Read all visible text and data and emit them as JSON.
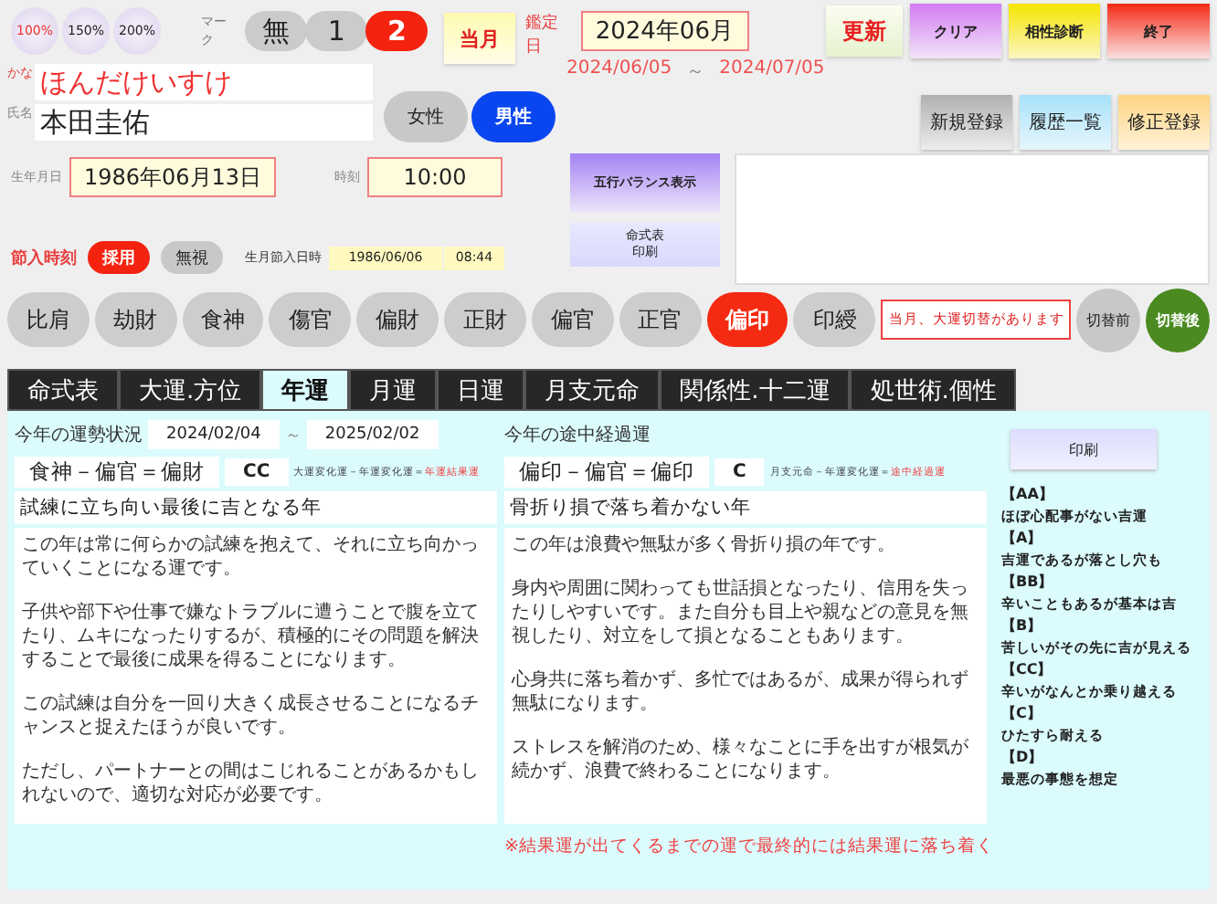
{
  "zoom_buttons": [
    {
      "label": "100%",
      "selected": true
    },
    {
      "label": "150%",
      "selected": false
    },
    {
      "label": "200%",
      "selected": false
    }
  ],
  "mark": {
    "label": "マーク",
    "options": [
      {
        "label": "無",
        "selected": false
      },
      {
        "label": "1",
        "selected": false
      },
      {
        "label": "2",
        "selected": true
      }
    ]
  },
  "month_button": "当月",
  "appraisal": {
    "label": "鑑定日",
    "value": "2024年06月",
    "range_start": "2024/06/05",
    "range_sep": "～",
    "range_end": "2024/07/05"
  },
  "update_button": "更新",
  "top_buttons": [
    {
      "label": "クリア",
      "kind": "clear"
    },
    {
      "label": "相性診断",
      "kind": "match"
    },
    {
      "label": "終了",
      "kind": "exit"
    }
  ],
  "record_buttons": [
    {
      "label": "新規登録",
      "kind": "new"
    },
    {
      "label": "履歴一覧",
      "kind": "history"
    },
    {
      "label": "修正登録",
      "kind": "edit"
    }
  ],
  "kana": {
    "label": "かな",
    "value": "ほんだけいすけ"
  },
  "name": {
    "label": "氏名",
    "value": "本田圭佑"
  },
  "gender": [
    {
      "label": "女性",
      "selected": false
    },
    {
      "label": "男性",
      "selected": true
    }
  ],
  "birth": {
    "label": "生年月日",
    "value": "1986年06月13日"
  },
  "time": {
    "label": "時刻",
    "value": "10:00"
  },
  "gogyo_button": "五行バランス表示",
  "print_chart_button": [
    "命式表",
    "印刷"
  ],
  "setsuiri": {
    "label": "節入時刻",
    "options": [
      {
        "label": "採用",
        "selected": true
      },
      {
        "label": "無視",
        "selected": false
      }
    ],
    "birth_month_label": "生月節入日時",
    "date": "1986/06/06",
    "time": "08:44"
  },
  "star_buttons": [
    {
      "label": "比肩",
      "selected": false
    },
    {
      "label": "劫財",
      "selected": false
    },
    {
      "label": "食神",
      "selected": false
    },
    {
      "label": "傷官",
      "selected": false
    },
    {
      "label": "偏財",
      "selected": false
    },
    {
      "label": "正財",
      "selected": false
    },
    {
      "label": "偏官",
      "selected": false
    },
    {
      "label": "正官",
      "selected": false
    },
    {
      "label": "偏印",
      "selected": true
    },
    {
      "label": "印綬",
      "selected": false
    }
  ],
  "notice": "当月、大運切替があります",
  "switch": [
    {
      "label": "切替前",
      "selected": false
    },
    {
      "label": "切替後",
      "selected": true
    }
  ],
  "tabs": [
    {
      "label": "命式表",
      "selected": false
    },
    {
      "label": "大運.方位",
      "selected": false
    },
    {
      "label": "年運",
      "selected": true
    },
    {
      "label": "月運",
      "selected": false
    },
    {
      "label": "日運",
      "selected": false
    },
    {
      "label": "月支元命",
      "selected": false
    },
    {
      "label": "関係性.十二運",
      "selected": false
    },
    {
      "label": "処世術.個性",
      "selected": false
    }
  ],
  "year": {
    "heading": "今年の運勢状況",
    "from": "2024/02/04",
    "sep": "～",
    "to": "2025/02/02",
    "formula": "食神－偏官＝偏財",
    "grade": "CC",
    "note": "大運変化運－年運変化運＝",
    "note_result": "年運結果運",
    "title": "試練に立ち向い最後に吉となる年",
    "paragraphs": [
      "この年は常に何らかの試練を抱えて、それに立ち向かっていくことになる運です。",
      "子供や部下や仕事で嫌なトラブルに遭うことで腹を立てたり、ムキになったりするが、積極的にその問題を解決することで最後に成果を得ることになります。",
      "この試練は自分を一回り大きく成長させることになるチャンスと捉えたほうが良いです。",
      "ただし、パートナーとの間はこじれることがあるかもしれないので、適切な対応が必要です。"
    ]
  },
  "interim": {
    "heading": "今年の途中経過運",
    "formula": "偏印－偏官＝偏印",
    "grade": "C",
    "note": "月支元命－年運変化運＝",
    "note_result": "途中経過運",
    "title": "骨折り損で落ち着かない年",
    "paragraphs": [
      "この年は浪費や無駄が多く骨折り損の年です。",
      "身内や周囲に関わっても世話損となったり、信用を失ったりしやすいです。また自分も目上や親などの意見を無視したり、対立をして損となることもあります。",
      "心身共に落ち着かず、多忙ではあるが、成果が得られず無駄になります。",
      "ストレスを解消のため、様々なことに手を出すが根気が続かず、浪費で終わることになります。"
    ],
    "footnote": "※結果運が出てくるまでの運で最終的には結果運に落ち着く"
  },
  "legend": {
    "print_button": "印刷",
    "items": [
      {
        "grade": "【AA】",
        "text": "ほぼ心配事がない吉運"
      },
      {
        "grade": "【A】",
        "text": "吉運であるが落とし穴も"
      },
      {
        "grade": "【BB】",
        "text": "辛いこともあるが基本は吉"
      },
      {
        "grade": "【B】",
        "text": "苦しいがその先に吉が見える"
      },
      {
        "grade": "【CC】",
        "text": "辛いがなんとか乗り越える"
      },
      {
        "grade": "【C】",
        "text": "ひたすら耐える"
      },
      {
        "grade": "【D】",
        "text": "最悪の事態を想定"
      }
    ]
  }
}
